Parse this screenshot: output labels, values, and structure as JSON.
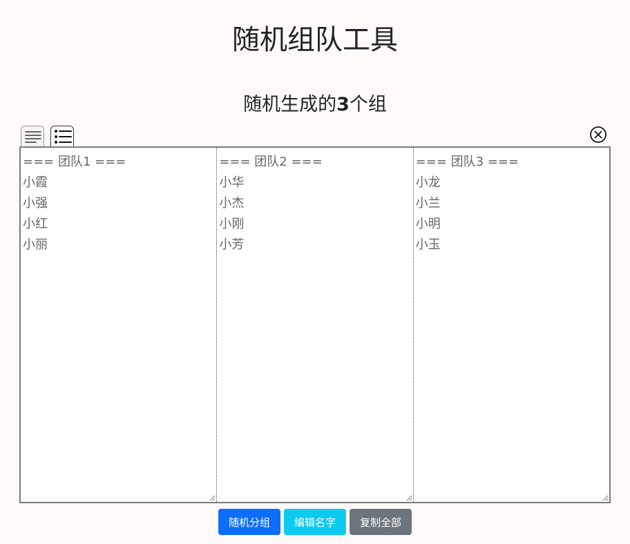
{
  "header": {
    "title": "随机组队工具",
    "subtitle_prefix": "随机生成的",
    "group_count": "3",
    "subtitle_suffix": "个组"
  },
  "view_tabs": [
    {
      "name": "text-view",
      "icon": "text-lines-icon",
      "active": false
    },
    {
      "name": "list-view",
      "icon": "bullet-list-icon",
      "active": true
    }
  ],
  "close_icon": "close-circle-icon",
  "groups": [
    {
      "header": "=== 团队1 ===",
      "members": [
        "小霞",
        "小强",
        "小红",
        "小丽"
      ]
    },
    {
      "header": "=== 团队2 ===",
      "members": [
        "小华",
        "小杰",
        "小刚",
        "小芳"
      ]
    },
    {
      "header": "=== 团队3 ===",
      "members": [
        "小龙",
        "小兰",
        "小明",
        "小玉"
      ]
    }
  ],
  "buttons": {
    "random_group": {
      "label": "随机分组",
      "color": "#0d6efd"
    },
    "edit_names": {
      "label": "编辑名字",
      "color": "#0dcaf0"
    },
    "copy_all": {
      "label": "复制全部",
      "color": "#6c757d"
    }
  }
}
